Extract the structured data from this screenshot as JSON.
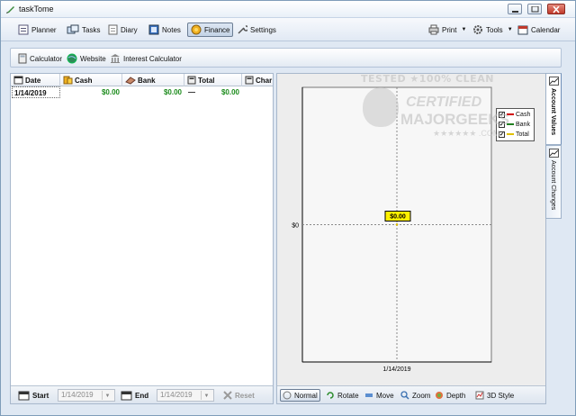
{
  "window": {
    "title": "taskTome"
  },
  "toolbar": {
    "planner": "Planner",
    "tasks": "Tasks",
    "diary": "Diary",
    "notes": "Notes",
    "finance": "Finance",
    "settings": "Settings",
    "print": "Print",
    "tools": "Tools",
    "calendar": "Calendar"
  },
  "subbar": {
    "calculator": "Calculator",
    "website": "Website",
    "interest": "Interest Calculator"
  },
  "grid": {
    "columns": [
      "Date",
      "Cash",
      "Bank",
      "Total",
      "Char"
    ],
    "rows": [
      {
        "date": "1/14/2019",
        "cash": "$0.00",
        "bank": "$0.00",
        "trend": "—",
        "total": "$0.00"
      }
    ]
  },
  "footer_left": {
    "start_label": "Start",
    "start_value": "1/14/2019",
    "end_label": "End",
    "end_value": "1/14/2019",
    "reset_label": "Reset"
  },
  "chart_data": {
    "type": "line",
    "categories": [
      "1/14/2019"
    ],
    "series": [
      {
        "name": "Cash",
        "values": [
          0
        ],
        "color": "#d00000"
      },
      {
        "name": "Bank",
        "values": [
          0
        ],
        "color": "#208020"
      },
      {
        "name": "Total",
        "values": [
          0
        ],
        "color": "#e0c000"
      }
    ],
    "y_tick_labels": [
      "$0"
    ],
    "x_tick_labels": [
      "1/14/2019"
    ],
    "data_label": "$0.00",
    "grid": true,
    "legend_position": "top-right"
  },
  "footer_right": {
    "normal": "Normal",
    "rotate": "Rotate",
    "move": "Move",
    "zoom": "Zoom",
    "depth": "Depth",
    "style3d": "3D Style"
  },
  "side_tabs": {
    "values": "Account Values",
    "changes": "Account Changes"
  },
  "watermark": {
    "line1": "TESTED ★100% CLEAN",
    "line2": "CERTIFIED",
    "line3": "MAJORGEEKS",
    "line4": "★★★★★★ .COM"
  },
  "colors": {
    "money": "#1a8a1a",
    "accent": "#fff000"
  }
}
